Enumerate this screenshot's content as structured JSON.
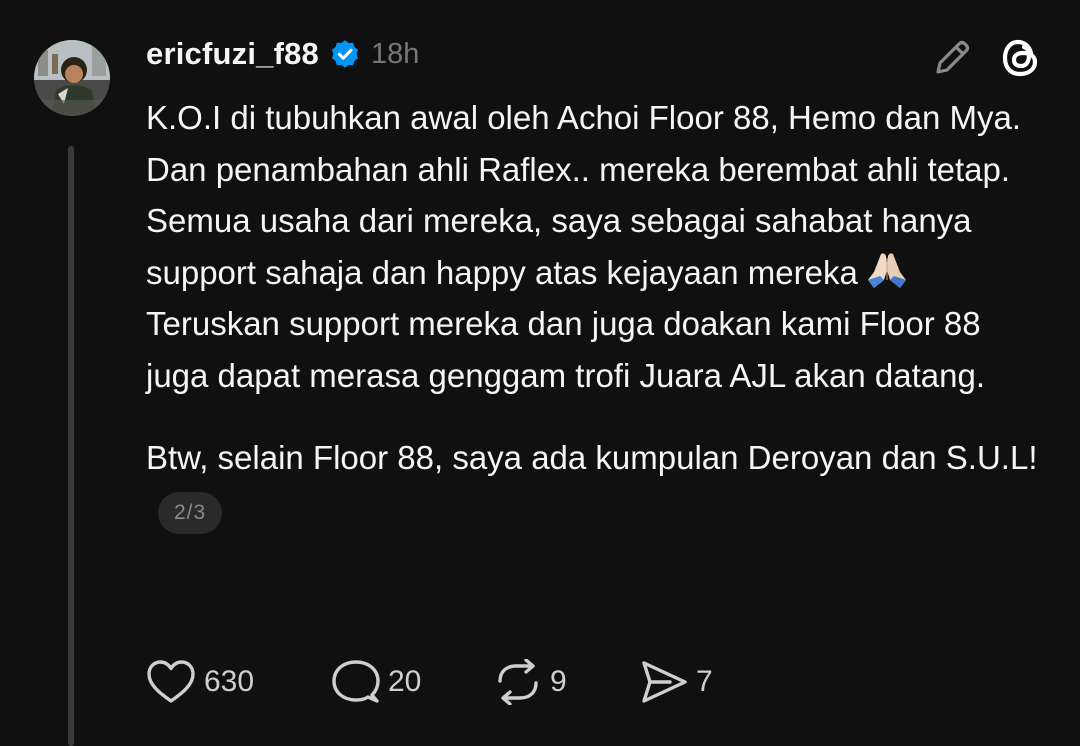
{
  "post": {
    "username": "ericfuzi_f88",
    "verified": true,
    "time": "18h",
    "paragraph1_line1": "K.O.I di tubuhkan awal oleh Achoi Floor 88, Hemo dan Mya. Dan penambahan ahli Raflex.. mereka berembat ahli tetap. Semua usaha dari mereka, saya sebagai sahabat hanya support sahaja dan happy atas kejayaan mereka",
    "emoji": "folded-hands",
    "paragraph1_line2": "Teruskan support mereka dan juga doakan kami Floor 88 juga dapat merasa genggam trofi Juara AJL akan datang.",
    "paragraph2": "Btw, selain Floor 88, saya ada kumpulan Deroyan dan S.U.L!",
    "page_indicator": "2/3"
  },
  "actions": {
    "likes": "630",
    "replies": "20",
    "reposts": "9",
    "shares": "7"
  },
  "icons": {
    "like": "heart-icon",
    "reply": "comment-bubble-icon",
    "repost": "repost-icon",
    "share": "send-icon",
    "edit": "pencil-icon",
    "brand": "threads-logo"
  },
  "colors": {
    "background": "#101010",
    "text": "#f3f5f7",
    "muted": "#777777",
    "verified_blue": "#0095f6"
  }
}
